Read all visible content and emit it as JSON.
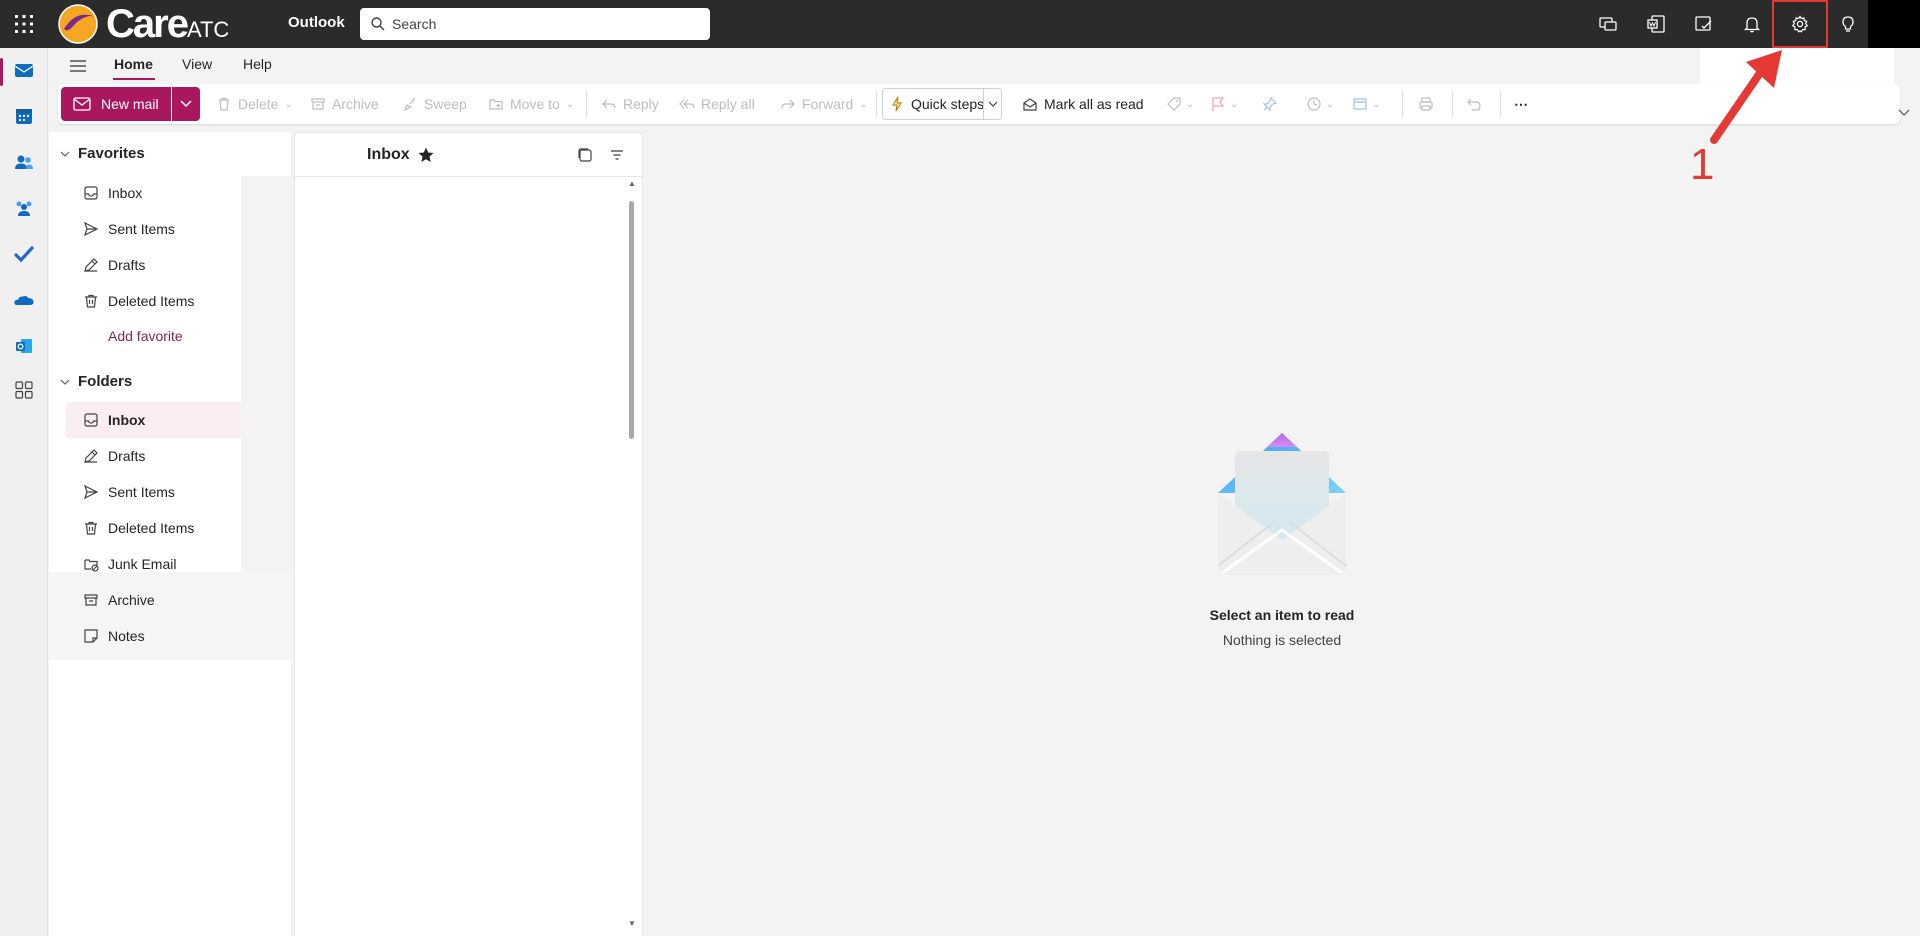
{
  "topbar": {
    "brand_main": "Care",
    "brand_suffix": "ATC",
    "app_name": "Outlook",
    "search_placeholder": "Search"
  },
  "ribbon": {
    "tabs": [
      {
        "label": "Home",
        "active": true
      },
      {
        "label": "View",
        "active": false
      },
      {
        "label": "Help",
        "active": false
      }
    ]
  },
  "toolbar": {
    "new_mail": "New mail",
    "delete": "Delete",
    "archive": "Archive",
    "sweep": "Sweep",
    "move_to": "Move to",
    "reply": "Reply",
    "reply_all": "Reply all",
    "forward": "Forward",
    "quick_steps": "Quick steps",
    "mark_all_read": "Mark all as read",
    "more": "⋯"
  },
  "favorites": {
    "header": "Favorites",
    "items": [
      {
        "label": "Inbox",
        "icon": "inbox-icon"
      },
      {
        "label": "Sent Items",
        "icon": "send-icon"
      },
      {
        "label": "Drafts",
        "icon": "drafts-icon"
      },
      {
        "label": "Deleted Items",
        "icon": "trash-icon"
      }
    ],
    "add_favorite": "Add favorite"
  },
  "folders": {
    "header": "Folders",
    "items": [
      {
        "label": "Inbox",
        "icon": "inbox-icon",
        "selected": true
      },
      {
        "label": "Drafts",
        "icon": "drafts-icon"
      },
      {
        "label": "Sent Items",
        "icon": "send-icon"
      },
      {
        "label": "Deleted Items",
        "icon": "trash-icon"
      },
      {
        "label": "Junk Email",
        "icon": "junk-icon"
      },
      {
        "label": "Archive",
        "icon": "archive-icon"
      },
      {
        "label": "Notes",
        "icon": "notes-icon"
      }
    ]
  },
  "message_list": {
    "title": "Inbox"
  },
  "reading_pane": {
    "title": "Select an item to read",
    "subtitle": "Nothing is selected"
  },
  "annotation": {
    "step_number": "1"
  },
  "colors": {
    "accent": "#a9175f",
    "topbar": "#2b2b2b",
    "annotation": "#e53935"
  }
}
